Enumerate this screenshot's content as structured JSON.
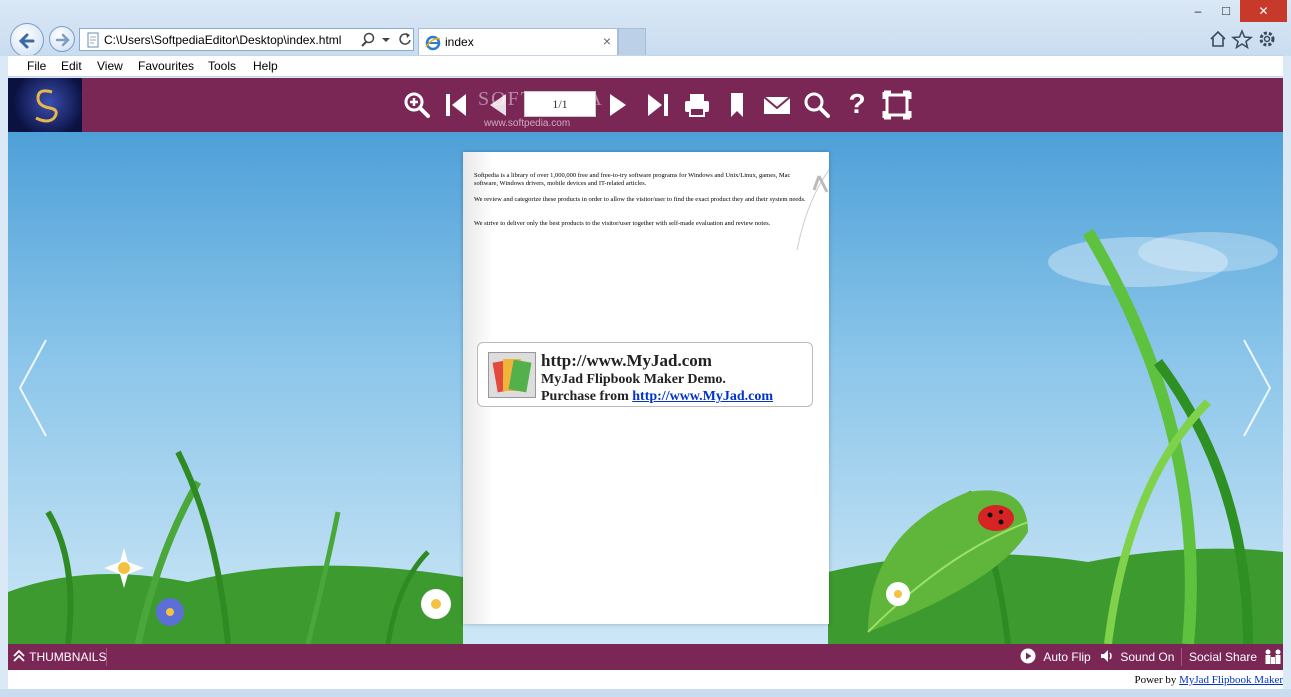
{
  "browser": {
    "address": "C:\\Users\\SoftpediaEditor\\Desktop\\index.html",
    "tab_title": "index",
    "tab_close": "×",
    "window_controls": {
      "minimize": "–",
      "maximize": "□",
      "close": "✕"
    }
  },
  "menu": [
    "File",
    "Edit",
    "View",
    "Favourites",
    "Tools",
    "Help"
  ],
  "toolbar": {
    "page_indicator": "1/1",
    "watermark": "SOFTPEDIA",
    "watermark_url": "www.softpedia.com",
    "help_label": "?"
  },
  "page": {
    "paragraphs": [
      "Softpedia is a library of over 1,000,000 free and free-to-try software programs for Windows and Unix/Linux, games, Mac software, Windows drivers, mobile devices and IT-related articles.",
      "We review and categorize these products in order to allow the visitor/user to find the exact product they and their system needs.",
      "We strive to deliver only the best products to the visitor/user together with self-made evaluation and review notes."
    ],
    "promo": {
      "line1": "http://www.MyJad.com",
      "line2": "MyJad Flipbook Maker Demo.",
      "line3_prefix": "Purchase from ",
      "line3_link": "http://www.MyJad.com"
    }
  },
  "bottom_bar": {
    "thumbnails": "THUMBNAILS",
    "auto_flip": "Auto Flip",
    "sound": "Sound On",
    "social_share": "Social Share"
  },
  "footer": {
    "prefix": "Power by ",
    "link": "MyJad Flipbook Maker"
  },
  "colors": {
    "toolbar": "#7b2756",
    "sky_top": "#4ea0d8",
    "sky_bottom": "#cde7f6"
  }
}
